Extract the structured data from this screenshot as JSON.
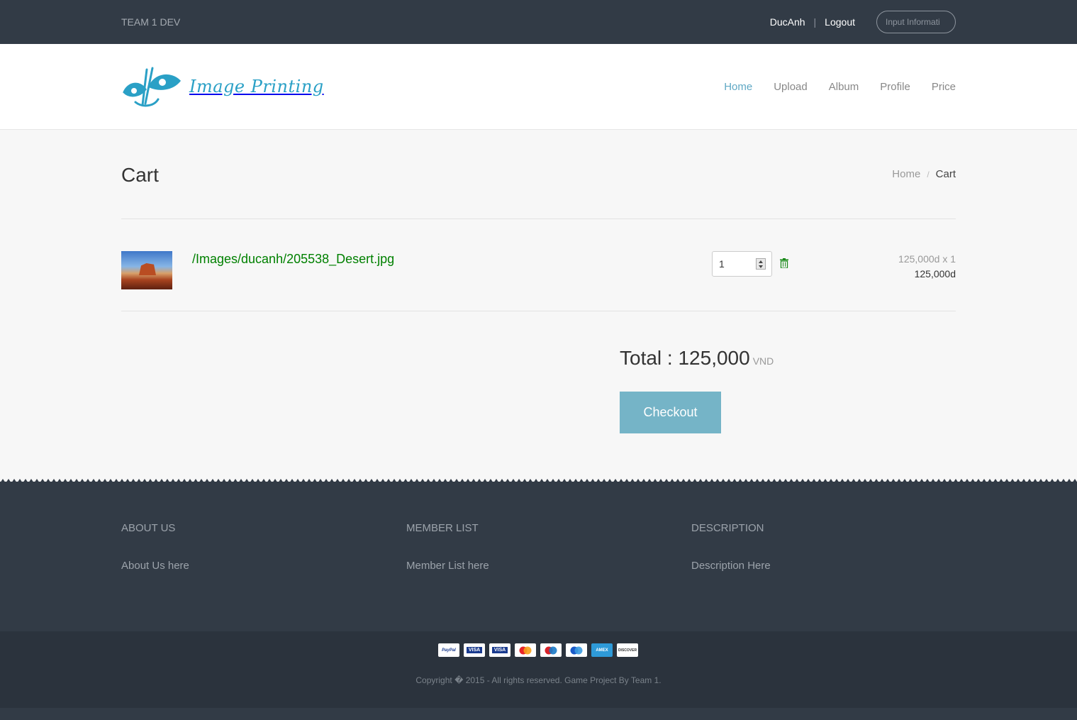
{
  "topbar": {
    "brand": "TEAM 1 DEV",
    "username": "DucAnh",
    "separator": "|",
    "logout": "Logout",
    "input_placeholder": "Input Informati"
  },
  "header": {
    "logo_text": "Image Printing",
    "nav": [
      "Home",
      "Upload",
      "Album",
      "Profile",
      "Price"
    ],
    "active_nav": "Home"
  },
  "page": {
    "title": "Cart",
    "breadcrumb": {
      "home": "Home",
      "separator": "/",
      "current": "Cart"
    }
  },
  "cart": {
    "items": [
      {
        "path": "/Images/ducanh/205538_Desert.jpg",
        "quantity": "1",
        "unit_price_line": "125,000d x 1",
        "subtotal": "125,000d"
      }
    ],
    "total_label": "Total : 125,000",
    "currency": "VND",
    "checkout_label": "Checkout"
  },
  "footer": {
    "columns": [
      {
        "heading": "ABOUT US",
        "text": "About Us here"
      },
      {
        "heading": "MEMBER LIST",
        "text": "Member List here"
      },
      {
        "heading": "DESCRIPTION",
        "text": "Description Here"
      }
    ],
    "payment_cards": [
      "PayPal",
      "VISA",
      "VISA",
      "MasterCard",
      "Maestro",
      "Maestro",
      "AMEX",
      "DISCOVER"
    ],
    "copyright": "Copyright � 2015 - All rights reserved. Game Project By Team 1."
  },
  "colors": {
    "dark_bar": "#323b46",
    "accent": "#5fa8c4",
    "checkout": "#75b4c7",
    "link_green": "#008000"
  }
}
